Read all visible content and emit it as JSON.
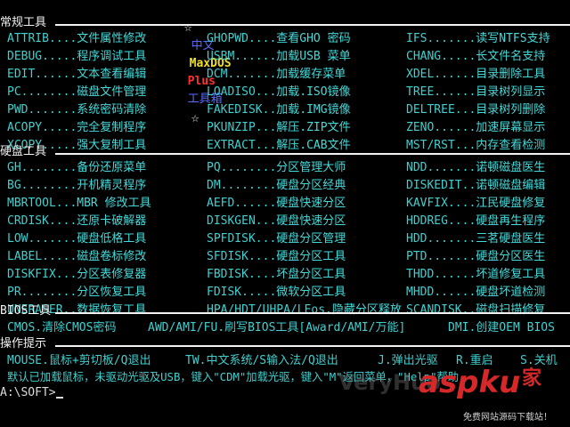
{
  "title": {
    "star_left": "☆",
    "zh": "中文",
    "maxdos": "MaxDOS",
    "plus": "Plus",
    "toolbox": "工具箱",
    "star_right": "☆",
    "colors": {
      "zh": "#5a6cff",
      "maxdos": "#f0e020",
      "plus": "#ff3030",
      "toolbox": "#5a6cff"
    }
  },
  "sections": {
    "common": "常规工具",
    "disk": "硬盘工具",
    "bios": "BIOS工具",
    "hints": "操作提示"
  },
  "common_tools": [
    [
      {
        "cmd": "ATTRIB....",
        "desc": "文件属性修改"
      },
      {
        "cmd": "GHOPWD....",
        "desc": "查看GHO 密码"
      },
      {
        "cmd": "IFS.......",
        "desc": "读写NTFS支持"
      }
    ],
    [
      {
        "cmd": "DEBUG.....",
        "desc": "程序调试工具"
      },
      {
        "cmd": "USBM......",
        "desc": "加载USB 菜单"
      },
      {
        "cmd": "CHANG.....",
        "desc": "长文件名支持"
      }
    ],
    [
      {
        "cmd": "EDIT......",
        "desc": "文本查看编辑"
      },
      {
        "cmd": "DCM.......",
        "desc": "加载缓存菜单"
      },
      {
        "cmd": "XDEL......",
        "desc": "目录删除工具"
      }
    ],
    [
      {
        "cmd": "PC........",
        "desc": "磁盘文件管理"
      },
      {
        "cmd": "LOADISO...",
        "desc": "加载.ISO镜像"
      },
      {
        "cmd": "TREE......",
        "desc": "目录树列显示"
      }
    ],
    [
      {
        "cmd": "PWD.......",
        "desc": "系统密码清除"
      },
      {
        "cmd": "FAKEDISK..",
        "desc": "加载.IMG镜像"
      },
      {
        "cmd": "DELTREE...",
        "desc": "目录树列删除"
      }
    ],
    [
      {
        "cmd": "ACOPY.....",
        "desc": "完全复制程序"
      },
      {
        "cmd": "PKUNZIP...",
        "desc": "解压.ZIP文件"
      },
      {
        "cmd": "ZENO......",
        "desc": "加速屏幕显示"
      }
    ],
    [
      {
        "cmd": "XCOPY.....",
        "desc": "强大复制工具"
      },
      {
        "cmd": "EXTRACT...",
        "desc": "解压.CAB文件"
      },
      {
        "cmd": "MST/RST...",
        "desc": "内存查看检测"
      }
    ]
  ],
  "disk_tools": [
    [
      {
        "cmd": "GH........",
        "desc": "备份还原菜单"
      },
      {
        "cmd": "PQ........",
        "desc": "分区管理大师"
      },
      {
        "cmd": "NDD.......",
        "desc": "诺顿磁盘医生"
      }
    ],
    [
      {
        "cmd": "BG........",
        "desc": "开机精灵程序"
      },
      {
        "cmd": "DM........",
        "desc": "硬盘分区经典"
      },
      {
        "cmd": "DISKEDIT..",
        "desc": "诺顿磁盘编辑"
      }
    ],
    [
      {
        "cmd": "MBRTOOL...",
        "desc": "MBR 修改工具"
      },
      {
        "cmd": "AEFD......",
        "desc": "硬盘快速分区"
      },
      {
        "cmd": "KAVFIX....",
        "desc": "江民硬盘修复"
      }
    ],
    [
      {
        "cmd": "CRDISK....",
        "desc": "还原卡破解器"
      },
      {
        "cmd": "DISKGEN...",
        "desc": "硬盘快速分区"
      },
      {
        "cmd": "HDDREG....",
        "desc": "硬盘再生程序"
      }
    ],
    [
      {
        "cmd": "LOW.......",
        "desc": "硬盘低格工具"
      },
      {
        "cmd": "SPFDISK...",
        "desc": "硬盘分区管理"
      },
      {
        "cmd": "HDD.......",
        "desc": "三茗硬盘医生"
      }
    ],
    [
      {
        "cmd": "LABEL.....",
        "desc": "磁盘卷标修改"
      },
      {
        "cmd": "SFDISK....",
        "desc": "硬盘分区工具"
      },
      {
        "cmd": "PTD.......",
        "desc": "硬盘分区医生"
      }
    ],
    [
      {
        "cmd": "DISKFIX...",
        "desc": "分区表修复器"
      },
      {
        "cmd": "FBDISK....",
        "desc": "坏盘分区工具"
      },
      {
        "cmd": "THDD......",
        "desc": "坏道修复工具"
      }
    ],
    [
      {
        "cmd": "PR........",
        "desc": "分区恢复工具"
      },
      {
        "cmd": "FDISK.....",
        "desc": "微软分区工具"
      },
      {
        "cmd": "MHDD......",
        "desc": "硬盘坏道检测"
      }
    ],
    [
      {
        "cmd": "UNERASER..",
        "desc": "数据恢复工具"
      },
      {
        "cmd": "HPA/HDT/UHPA/LEos.",
        "desc": "隐藏分区释放"
      },
      {
        "cmd": "SCANDISK..",
        "desc": "磁盘扫描修复"
      }
    ]
  ],
  "bios_line": {
    "a": "CMOS.清除CMOS密码",
    "b": "AWD/AMI/FU.刷写BIOS工具[Award/AMI/万能]",
    "c": "DMI.创建OEM BIOS"
  },
  "hints": {
    "line1": {
      "a": "MOUSE.鼠标+剪切板/Q退出",
      "b": "TW.中文系统/S输入法/Q退出",
      "c": "J.弹出光驱",
      "d": "R.重启",
      "e": "S.关机"
    },
    "line2": "默认已加载鼠标，未驱动光驱及USB，键入\"CDM\"加载光驱，键入\"M\"返回菜单，\"Help\"帮助"
  },
  "prompt": "A:\\SOFT>",
  "watermark": "VeryHuo",
  "logo": {
    "text": "aspku",
    "sub": "免费网站源码下载站！",
    "char": "家"
  }
}
